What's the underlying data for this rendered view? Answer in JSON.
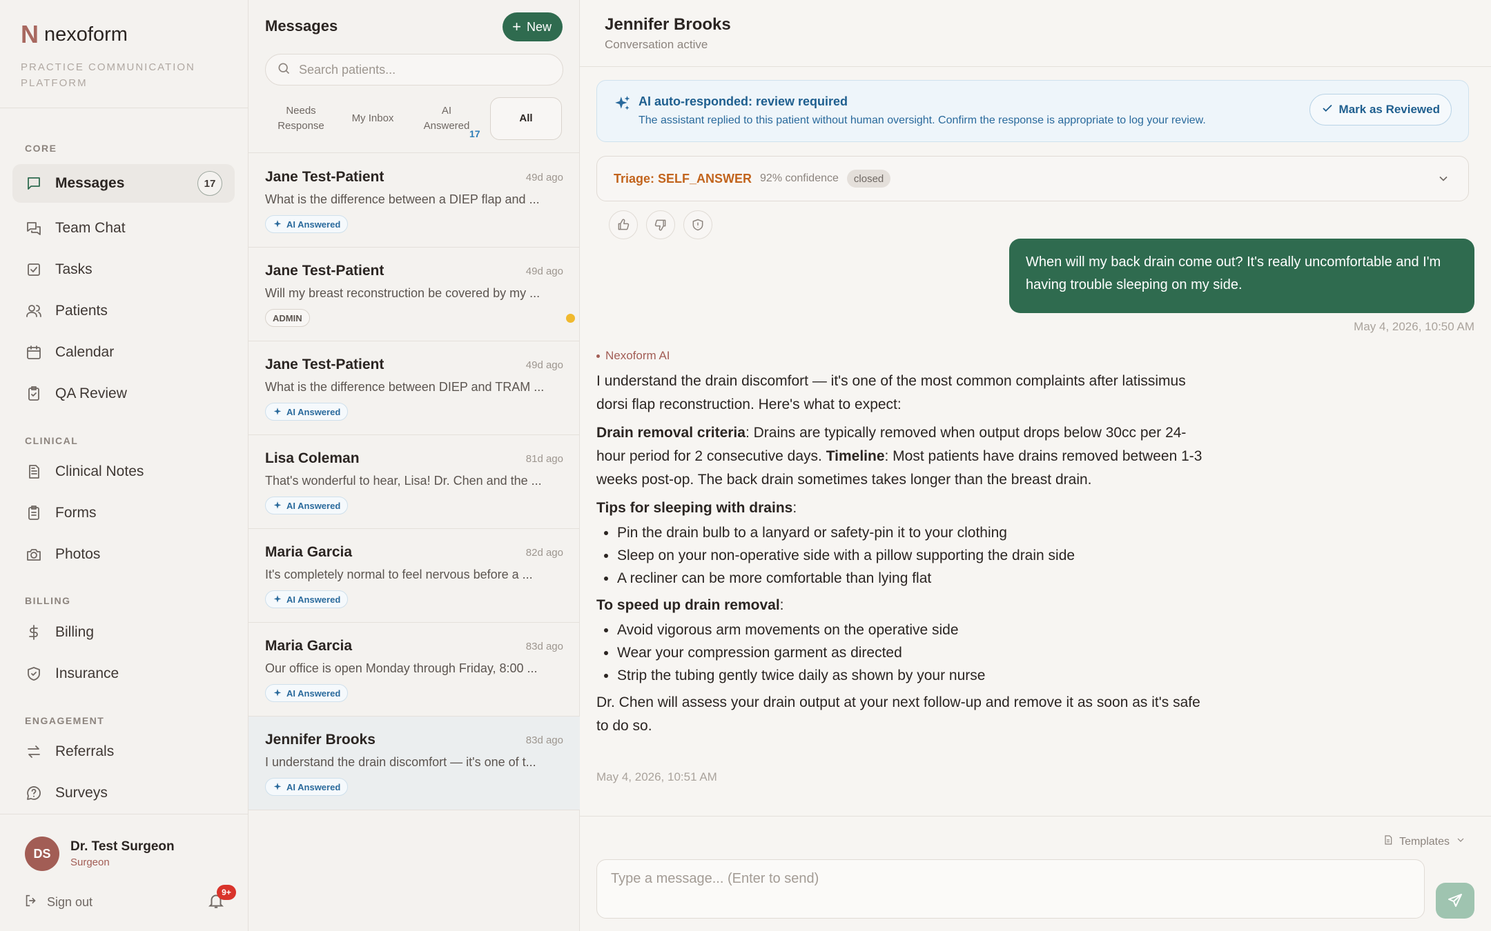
{
  "brand": {
    "letter": "N",
    "name": "nexoform",
    "tagline": "PRACTICE COMMUNICATION PLATFORM"
  },
  "sidebar": {
    "sections": {
      "core": "CORE",
      "clinical": "CLINICAL",
      "billing": "BILLING",
      "engagement": "ENGAGEMENT"
    },
    "items": {
      "messages": {
        "label": "Messages",
        "count": "17",
        "icon": "message-square-icon"
      },
      "team_chat": {
        "label": "Team Chat",
        "icon": "messages-icon"
      },
      "tasks": {
        "label": "Tasks",
        "icon": "checkbox-icon"
      },
      "patients": {
        "label": "Patients",
        "icon": "users-icon"
      },
      "calendar": {
        "label": "Calendar",
        "icon": "calendar-icon"
      },
      "qa_review": {
        "label": "QA Review",
        "icon": "clipboard-check-icon"
      },
      "clinical_notes": {
        "label": "Clinical Notes",
        "icon": "file-text-icon"
      },
      "forms": {
        "label": "Forms",
        "icon": "clipboard-icon"
      },
      "photos": {
        "label": "Photos",
        "icon": "camera-icon"
      },
      "billing": {
        "label": "Billing",
        "icon": "dollar-icon"
      },
      "insurance": {
        "label": "Insurance",
        "icon": "shield-icon"
      },
      "referrals": {
        "label": "Referrals",
        "icon": "arrows-icon"
      },
      "surveys": {
        "label": "Surveys",
        "icon": "help-circle-icon"
      }
    },
    "user": {
      "initials": "DS",
      "name": "Dr. Test Surgeon",
      "role": "Surgeon"
    },
    "signout": "Sign out",
    "notifications_badge": "9+"
  },
  "list": {
    "title": "Messages",
    "new_label": "New",
    "search_placeholder": "Search patients...",
    "tabs": {
      "needs_response": "Needs Response",
      "my_inbox": "My Inbox",
      "ai_answered": "AI Answered",
      "ai_answered_count": "17",
      "all": "All"
    },
    "conversations": [
      {
        "name": "Jane Test-Patient",
        "time": "49d ago",
        "preview": "What is the difference between a DIEP flap and ...",
        "tag": "AI Answered"
      },
      {
        "name": "Jane Test-Patient",
        "time": "49d ago",
        "preview": "Will my breast reconstruction be covered by my ...",
        "tag": "ADMIN"
      },
      {
        "name": "Jane Test-Patient",
        "time": "49d ago",
        "preview": "What is the difference between DIEP and TRAM ...",
        "tag": "AI Answered"
      },
      {
        "name": "Lisa Coleman",
        "time": "81d ago",
        "preview": "That's wonderful to hear, Lisa! Dr. Chen and the ...",
        "tag": "AI Answered"
      },
      {
        "name": "Maria Garcia",
        "time": "82d ago",
        "preview": "It's completely normal to feel nervous before a ...",
        "tag": "AI Answered"
      },
      {
        "name": "Maria Garcia",
        "time": "83d ago",
        "preview": "Our office is open Monday through Friday, 8:00 ...",
        "tag": "AI Answered"
      },
      {
        "name": "Jennifer Brooks",
        "time": "83d ago",
        "preview": "I understand the drain discomfort — it's one of t...",
        "tag": "AI Answered"
      }
    ]
  },
  "chat": {
    "name": "Jennifer Brooks",
    "status": "Conversation active",
    "alert": {
      "title": "AI auto-responded: review required",
      "text": "The assistant replied to this patient without human oversight. Confirm the response is appropriate to log your review.",
      "button": "Mark as Reviewed"
    },
    "triage": {
      "label": "Triage: SELF_ANSWER",
      "confidence": "92% confidence",
      "status": "closed"
    },
    "patient_message": "When will my back drain come out? It's really uncomfortable and I'm having trouble sleeping on my side.",
    "patient_time": "May 4, 2026, 10:50 AM",
    "ai_sender": "Nexoform AI",
    "ai_message": {
      "intro": "I understand the drain discomfort — it's one of the most common complaints after latissimus dorsi flap reconstruction. Here's what to expect:",
      "criteria_heading": "Drain removal criteria",
      "criteria_text": ": Drains are typically removed when output drops below 30cc per 24-hour period for 2 consecutive days. ",
      "timeline_heading": "Timeline",
      "timeline_text": ": Most patients have drains removed between 1-3 weeks post-op. The back drain sometimes takes longer than the breast drain.",
      "tips_heading": "Tips for sleeping with drains",
      "tips": [
        "Pin the drain bulb to a lanyard or safety-pin it to your clothing",
        "Sleep on your non-operative side with a pillow supporting the drain side",
        "A recliner can be more comfortable than lying flat"
      ],
      "speed_heading": "To speed up drain removal",
      "speed": [
        "Avoid vigorous arm movements on the operative side",
        "Wear your compression garment as directed",
        "Strip the tubing gently twice daily as shown by your nurse"
      ],
      "closing": "Dr. Chen will assess your drain output at your next follow-up and remove it as soon as it's safe to do so."
    },
    "ai_time": "May 4, 2026, 10:51 AM",
    "templates_label": "Templates",
    "composer_placeholder": "Type a message... (Enter to send)"
  },
  "colors": {
    "primary_green": "#2f6b4f",
    "brand_rose": "#a25d55",
    "info_blue": "#2a6a9c",
    "triage_orange": "#c2641d"
  }
}
